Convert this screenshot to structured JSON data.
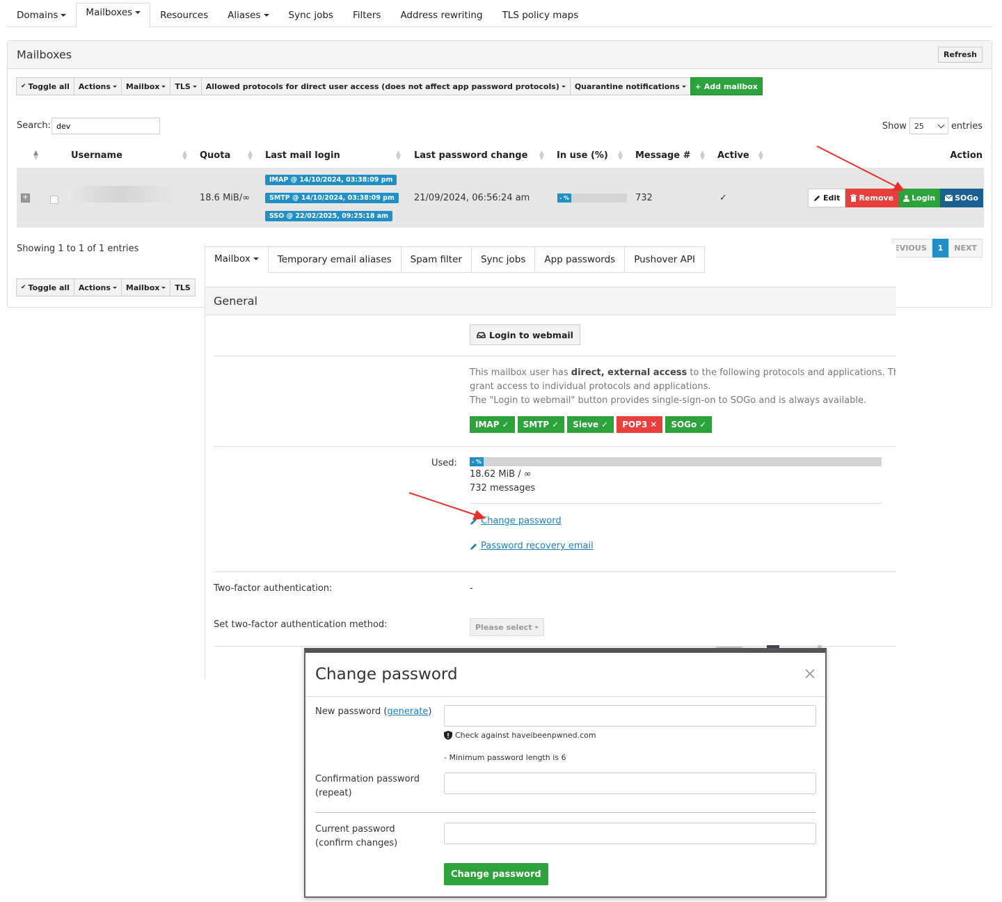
{
  "top_tabs": [
    {
      "label": "Domains",
      "caret": true
    },
    {
      "label": "Mailboxes",
      "caret": true,
      "active": true
    },
    {
      "label": "Resources",
      "caret": false
    },
    {
      "label": "Aliases",
      "caret": true
    },
    {
      "label": "Sync jobs",
      "caret": false
    },
    {
      "label": "Filters",
      "caret": false
    },
    {
      "label": "Address rewriting",
      "caret": false
    },
    {
      "label": "TLS policy maps",
      "caret": false
    }
  ],
  "panel": {
    "title": "Mailboxes",
    "refresh_label": "Refresh"
  },
  "toolbar": {
    "toggle_all": "Toggle all",
    "actions": "Actions",
    "mailbox": "Mailbox",
    "tls": "TLS",
    "protocols": "Allowed protocols for direct user access (does not affect app password protocols)",
    "quarantine": "Quarantine notifications",
    "add_mailbox": "+ Add mailbox"
  },
  "search": {
    "label": "Search:",
    "value": "dev"
  },
  "show": {
    "label": "Show",
    "value": "25",
    "suffix": "entries"
  },
  "table": {
    "headers": {
      "username": "Username",
      "quota": "Quota",
      "last_login": "Last mail login",
      "last_pw": "Last password change",
      "in_use": "In use (%)",
      "messages": "Message #",
      "active": "Active",
      "action": "Action"
    },
    "row": {
      "expander": "+",
      "quota": "18.6 MiB/∞",
      "logins": [
        "IMAP @ 14/10/2024, 03:38:09 pm",
        "SMTP @ 14/10/2024, 03:38:09 pm",
        "SSO @ 22/02/2025, 09:25:18 am"
      ],
      "last_pw": "21/09/2024, 06:56:24 am",
      "in_use": "- %",
      "messages": "732",
      "active": "✓"
    },
    "actions": {
      "edit": "Edit",
      "remove": "Remove",
      "login": "Login",
      "sogo": "SOGo"
    }
  },
  "showing": "Showing 1 to 1 of 1 entries",
  "pager": {
    "previous": "PREVIOUS",
    "current": "1",
    "next": "NEXT"
  },
  "bottom_toolbar": {
    "toggle_all": "Toggle all",
    "actions": "Actions",
    "mailbox": "Mailbox",
    "tls": "TLS"
  },
  "edit": {
    "tabs": [
      "Mailbox",
      "Temporary email aliases",
      "Spam filter",
      "Sync jobs",
      "App passwords",
      "Pushover API"
    ],
    "general_title": "General",
    "webmail_btn": "Login to webmail",
    "access_line1_pre": "This mailbox user has ",
    "access_line1_bold": "direct, external access",
    "access_line1_post": " to the following protocols and applications. This setting",
    "access_line2": "grant access to individual protocols and applications.",
    "access_line3": "The \"Login to webmail\" button provides single-sign-on to SOGo and is always available.",
    "protocols": [
      {
        "name": "IMAP",
        "state": "✓",
        "enabled": true
      },
      {
        "name": "SMTP",
        "state": "✓",
        "enabled": true
      },
      {
        "name": "Sieve",
        "state": "✓",
        "enabled": true
      },
      {
        "name": "POP3",
        "state": "✕",
        "enabled": false
      },
      {
        "name": "SOGo",
        "state": "✓",
        "enabled": true
      }
    ],
    "used_label": "Used:",
    "used_pct": "- %",
    "used_size": "18.62 MiB / ∞",
    "used_messages": "732 messages",
    "change_password_link": "Change password",
    "recovery_link": "Password recovery email",
    "twofa_label": "Two-factor authentication:",
    "twofa_value": "-",
    "set_twofa_label": "Set two-factor authentication method:",
    "please_select": "Please select"
  },
  "modal": {
    "title": "Change password",
    "new_pw_label": "New password (",
    "generate": "generate",
    "new_pw_label_end": ")",
    "hibp": "Check against haveibeenpwned.com",
    "min_length": "- Minimum password length is 6",
    "confirm_label_1": "Confirmation password",
    "confirm_label_2": "(repeat)",
    "current_label_1": "Current password",
    "current_label_2": "(confirm changes)",
    "submit": "Change password"
  },
  "colors": {
    "green": "#2ca33a",
    "red": "#e8403c",
    "blue": "#1f8fc6",
    "dark_blue": "#17608f",
    "arrow": "#e8302a"
  }
}
